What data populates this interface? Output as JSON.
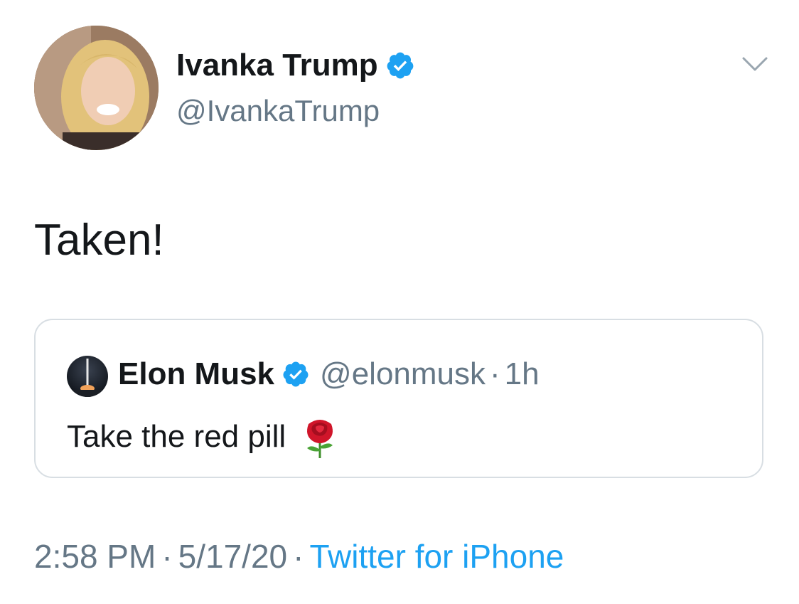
{
  "tweet": {
    "author": {
      "name": "Ivanka Trump",
      "handle": "@IvankaTrump",
      "verified": true
    },
    "text": "Taken!",
    "quoted": {
      "author_name": "Elon Musk",
      "handle": "@elonmusk",
      "separator": "·",
      "time": "1h",
      "verified": true,
      "text": "Take the red pill",
      "emoji_icon": "rose-icon"
    },
    "meta": {
      "time": "2:58 PM",
      "separator1": "·",
      "date": "5/17/20",
      "separator2": "·",
      "source": "Twitter for iPhone"
    }
  },
  "icons": {
    "menu": "chevron-down-icon",
    "verified": "verified-badge-icon"
  },
  "colors": {
    "text_primary": "#14171a",
    "text_secondary": "#657786",
    "link": "#1da1f2",
    "verified": "#1da1f2",
    "border": "#d8dee3"
  }
}
